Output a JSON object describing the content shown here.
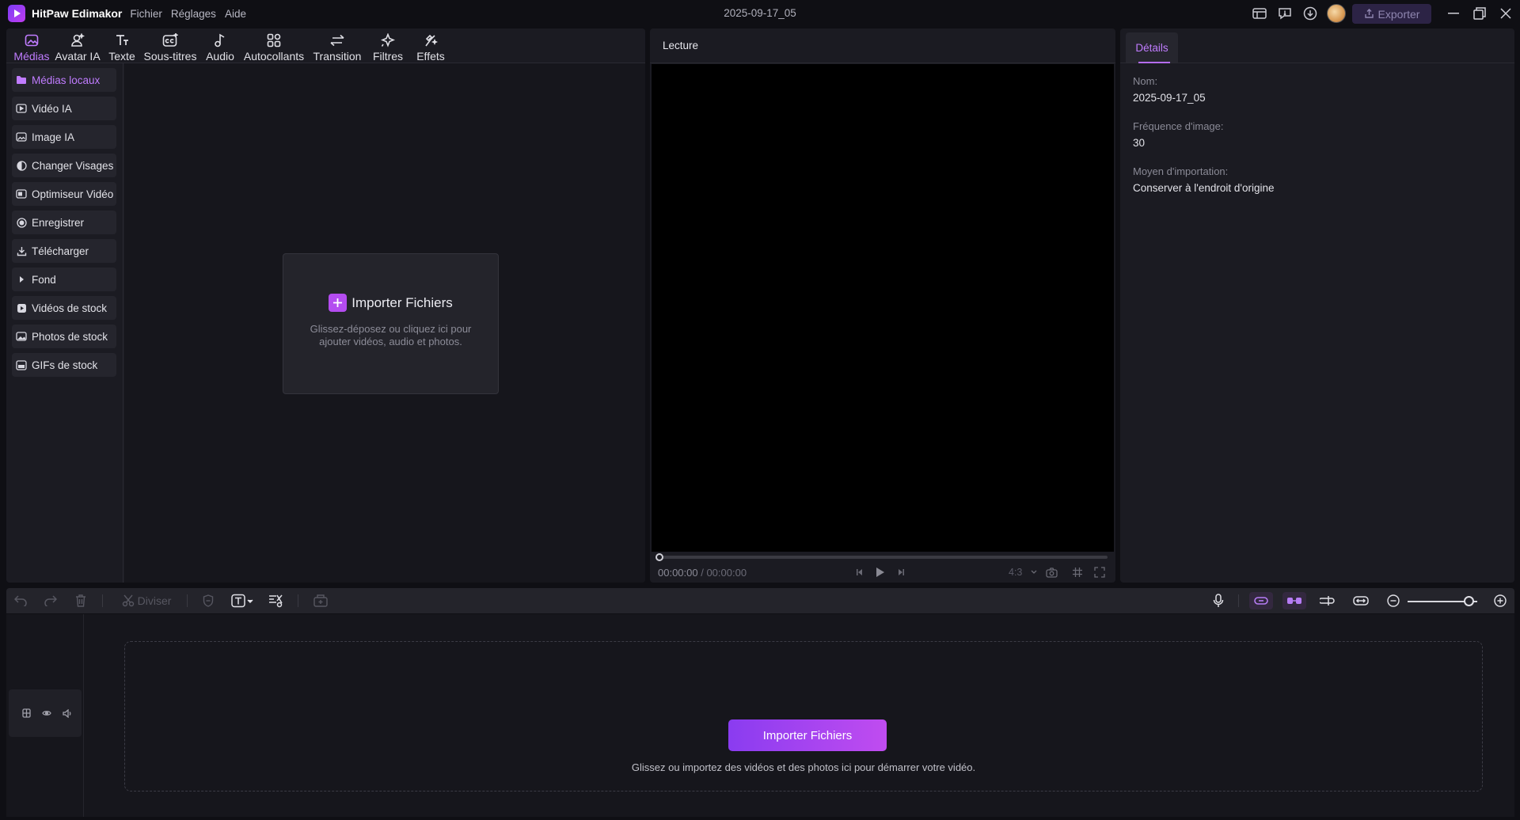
{
  "app": {
    "name": "HitPaw Edimakor",
    "menu": [
      "Fichier",
      "Réglages",
      "Aide"
    ],
    "project_title": "2025-09-17_05",
    "export_label": "Exporter"
  },
  "media_tabs": [
    {
      "label": "Médias",
      "icon": "media-icon",
      "active": true
    },
    {
      "label": "Avatar IA",
      "icon": "avatar-icon"
    },
    {
      "label": "Texte",
      "icon": "text-icon"
    },
    {
      "label": "Sous-titres",
      "icon": "subtitles-icon"
    },
    {
      "label": "Audio",
      "icon": "audio-icon"
    },
    {
      "label": "Autocollants",
      "icon": "stickers-icon"
    },
    {
      "label": "Transition",
      "icon": "transition-icon"
    },
    {
      "label": "Filtres",
      "icon": "filters-icon"
    },
    {
      "label": "Effets",
      "icon": "effects-icon"
    }
  ],
  "sidebar": {
    "items": [
      {
        "label": "Médias locaux",
        "icon": "folder-icon",
        "active": true
      },
      {
        "label": "Vidéo IA",
        "icon": "ai-video-icon"
      },
      {
        "label": "Image IA",
        "icon": "ai-image-icon"
      },
      {
        "label": "Changer Visages",
        "icon": "face-swap-icon"
      },
      {
        "label": "Optimiseur Vidéo",
        "icon": "video-enhancer-icon"
      },
      {
        "label": "Enregistrer",
        "icon": "record-icon"
      },
      {
        "label": "Télécharger",
        "icon": "download-icon"
      },
      {
        "label": "Fond",
        "icon": "caret-right-icon"
      },
      {
        "label": "Vidéos de stock",
        "icon": "stock-video-icon"
      },
      {
        "label": "Photos de stock",
        "icon": "stock-photo-icon"
      },
      {
        "label": "GIFs de stock",
        "icon": "stock-gif-icon"
      }
    ]
  },
  "import_card": {
    "title": "Importer Fichiers",
    "description": "Glissez-déposez ou cliquez ici pour ajouter vidéos, audio et photos."
  },
  "player": {
    "title": "Lecture",
    "current_time": "00:00:00",
    "separator": " / ",
    "total_time": "00:00:00",
    "aspect_ratio": "4:3",
    "progress": 0
  },
  "details": {
    "tab_label": "Détails",
    "fields": [
      {
        "label": "Nom:",
        "value": "2025-09-17_05"
      },
      {
        "label": "Fréquence d'image:",
        "value": "30"
      },
      {
        "label": "Moyen d'importation:",
        "value": "Conserver à l'endroit d'origine"
      }
    ]
  },
  "timeline_toolbar": {
    "split_label": "Diviser",
    "zoom_level": 0.88
  },
  "timeline": {
    "import_button": "Importer Fichiers",
    "hint": "Glissez ou importez des vidéos et des photos ici pour démarrer votre vidéo."
  },
  "colors": {
    "accent": "#b44cf0",
    "active_text": "#c07cff",
    "background": "#0f0f14",
    "panel": "#1b1b22"
  }
}
